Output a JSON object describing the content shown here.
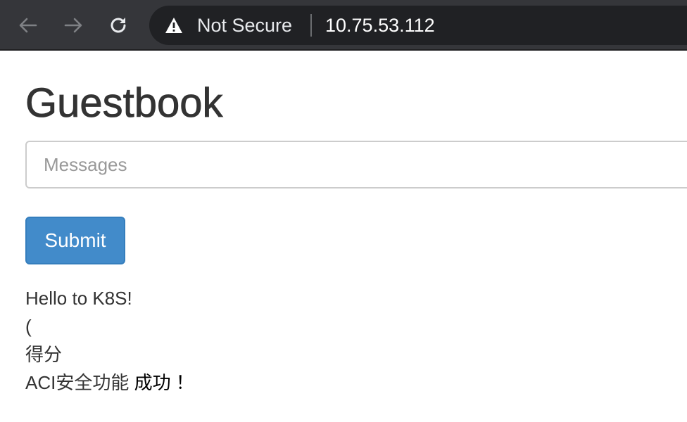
{
  "browser": {
    "security_label": "Not Secure",
    "url": "10.75.53.112",
    "icons": [
      "back-arrow-icon",
      "forward-arrow-icon",
      "reload-icon",
      "warning-icon"
    ]
  },
  "page": {
    "title": "Guestbook",
    "input_placeholder": "Messages",
    "submit_label": "Submit",
    "entries": [
      "Hello to K8S!",
      "(",
      "得分",
      "ACI安全功能"
    ],
    "entry_suffix": "成功 ！"
  }
}
